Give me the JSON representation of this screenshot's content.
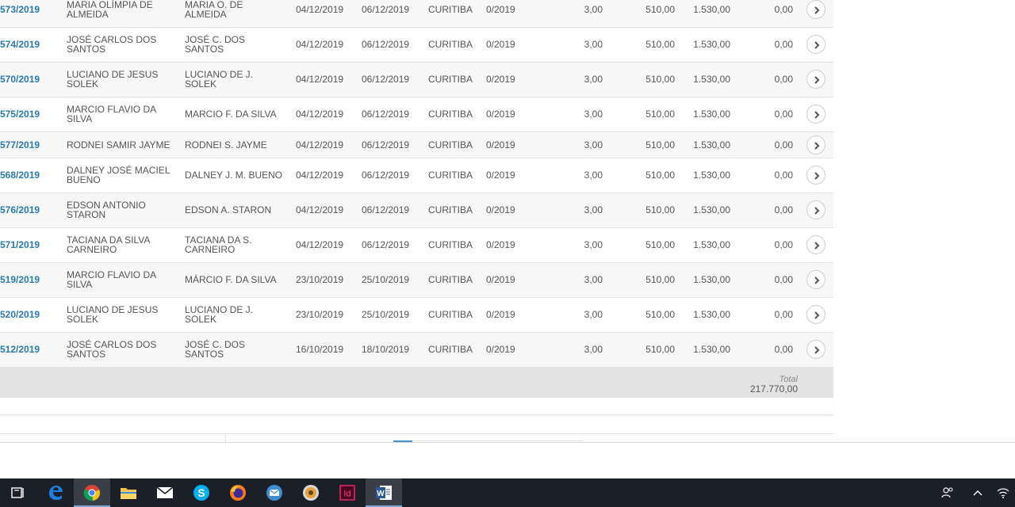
{
  "rows": [
    {
      "num": "573/2019",
      "name": "MARIA OLÍMPIA DE ALMEIDA",
      "short": "MARIA O. DE ALMEIDA",
      "start": "04/12/2019",
      "end": "06/12/2019",
      "city": "CURITIBA",
      "ref": "0/2019",
      "qty": "3,00",
      "unit": "510,00",
      "total": "1.530,00",
      "disc": "0,00"
    },
    {
      "num": "574/2019",
      "name": "JOSÉ CARLOS DOS SANTOS",
      "short": "JOSÉ C. DOS SANTOS",
      "start": "04/12/2019",
      "end": "06/12/2019",
      "city": "CURITIBA",
      "ref": "0/2019",
      "qty": "3,00",
      "unit": "510,00",
      "total": "1.530,00",
      "disc": "0,00"
    },
    {
      "num": "570/2019",
      "name": "LUCIANO DE JESUS SOLEK",
      "short": "LUCIANO DE J. SOLEK",
      "start": "04/12/2019",
      "end": "06/12/2019",
      "city": "CURITIBA",
      "ref": "0/2019",
      "qty": "3,00",
      "unit": "510,00",
      "total": "1.530,00",
      "disc": "0,00"
    },
    {
      "num": "575/2019",
      "name": "MARCIO FLAVIO DA SILVA",
      "short": "MARCIO F. DA SILVA",
      "start": "04/12/2019",
      "end": "06/12/2019",
      "city": "CURITIBA",
      "ref": "0/2019",
      "qty": "3,00",
      "unit": "510,00",
      "total": "1.530,00",
      "disc": "0,00"
    },
    {
      "num": "577/2019",
      "name": "RODNEI SAMIR JAYME",
      "short": "RODNEI S. JAYME",
      "start": "04/12/2019",
      "end": "06/12/2019",
      "city": "CURITIBA",
      "ref": "0/2019",
      "qty": "3,00",
      "unit": "510,00",
      "total": "1.530,00",
      "disc": "0,00"
    },
    {
      "num": "568/2019",
      "name": "DALNEY JOSÉ MACIEL BUENO",
      "short": "DALNEY J. M. BUENO",
      "start": "04/12/2019",
      "end": "06/12/2019",
      "city": "CURITIBA",
      "ref": "0/2019",
      "qty": "3,00",
      "unit": "510,00",
      "total": "1.530,00",
      "disc": "0,00"
    },
    {
      "num": "576/2019",
      "name": "EDSON ANTONIO STARON",
      "short": "EDSON A. STARON",
      "start": "04/12/2019",
      "end": "06/12/2019",
      "city": "CURITIBA",
      "ref": "0/2019",
      "qty": "3,00",
      "unit": "510,00",
      "total": "1.530,00",
      "disc": "0,00"
    },
    {
      "num": "571/2019",
      "name": "TACIANA DA SILVA CARNEIRO",
      "short": "TACIANA DA S. CARNEIRO",
      "start": "04/12/2019",
      "end": "06/12/2019",
      "city": "CURITIBA",
      "ref": "0/2019",
      "qty": "3,00",
      "unit": "510,00",
      "total": "1.530,00",
      "disc": "0,00"
    },
    {
      "num": "519/2019",
      "name": "MARCIO FLAVIO DA SILVA",
      "short": "MÁRCIO F. DA SILVA",
      "start": "23/10/2019",
      "end": "25/10/2019",
      "city": "CURITIBA",
      "ref": "0/2019",
      "qty": "3,00",
      "unit": "510,00",
      "total": "1.530,00",
      "disc": "0,00"
    },
    {
      "num": "520/2019",
      "name": "LUCIANO DE JESUS SOLEK",
      "short": "LUCIANO DE J. SOLEK",
      "start": "23/10/2019",
      "end": "25/10/2019",
      "city": "CURITIBA",
      "ref": "0/2019",
      "qty": "3,00",
      "unit": "510,00",
      "total": "1.530,00",
      "disc": "0,00"
    },
    {
      "num": "512/2019",
      "name": "JOSÉ CARLOS DOS SANTOS",
      "short": "JOSÉ C. DOS SANTOS",
      "start": "16/10/2019",
      "end": "18/10/2019",
      "city": "CURITIBA",
      "ref": "0/2019",
      "qty": "3,00",
      "unit": "510,00",
      "total": "1.530,00",
      "disc": "0,00"
    }
  ],
  "footer": {
    "total_label": "Total",
    "total_value": "217.770,00"
  },
  "taskbar": {
    "apps": [
      {
        "icon": "task-view-icon"
      },
      {
        "icon": "edge-icon"
      },
      {
        "icon": "chrome-icon",
        "active": true
      },
      {
        "icon": "file-explorer-icon"
      },
      {
        "icon": "mail-icon"
      },
      {
        "icon": "skype-icon"
      },
      {
        "icon": "firefox-icon"
      },
      {
        "icon": "outlook-icon"
      },
      {
        "icon": "media-player-icon"
      },
      {
        "icon": "indesign-icon",
        "label": "Id"
      },
      {
        "icon": "word-icon",
        "label": "W"
      }
    ],
    "tray": [
      "people-icon",
      "chevron-up-icon",
      "wifi-icon"
    ]
  }
}
